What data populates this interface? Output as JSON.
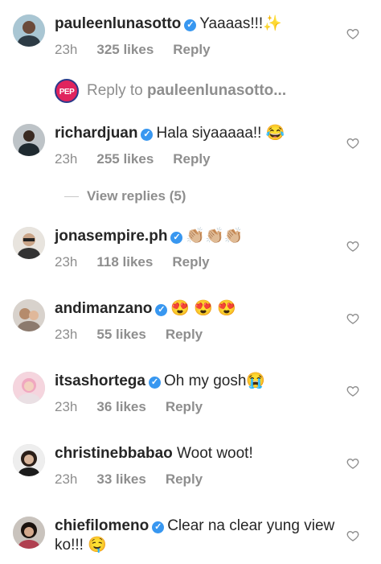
{
  "comments": [
    {
      "username": "pauleenlunasotto",
      "verified": true,
      "text": "Yaaaas!!!✨",
      "time": "23h",
      "likes": "325 likes",
      "reply": "Reply"
    },
    {
      "username": "richardjuan",
      "verified": true,
      "text": "Hala siyaaaaa!! 😂",
      "time": "23h",
      "likes": "255 likes",
      "reply": "Reply"
    },
    {
      "username": "jonasempire.ph",
      "verified": true,
      "text": "👏🏼👏🏼👏🏼",
      "time": "23h",
      "likes": "118 likes",
      "reply": "Reply"
    },
    {
      "username": "andimanzano",
      "verified": true,
      "text": "😍 😍 😍",
      "time": "23h",
      "likes": "55 likes",
      "reply": "Reply"
    },
    {
      "username": "itsashortega",
      "verified": true,
      "text": "Oh my gosh😭",
      "time": "23h",
      "likes": "36 likes",
      "reply": "Reply"
    },
    {
      "username": "christinebbabao",
      "verified": false,
      "text": "Woot woot!",
      "time": "23h",
      "likes": "33 likes",
      "reply": "Reply"
    },
    {
      "username": "chiefilomeno",
      "verified": true,
      "text": "Clear na clear yung view ko!!! 🤤"
    }
  ],
  "reply_to": {
    "logo_text": "PEP",
    "prefix": "Reply to",
    "target": "pauleenlunasotto..."
  },
  "view_replies": "View replies (5)",
  "icons": {
    "heart": "heart-outline-icon",
    "verified": "verified-badge-icon"
  }
}
